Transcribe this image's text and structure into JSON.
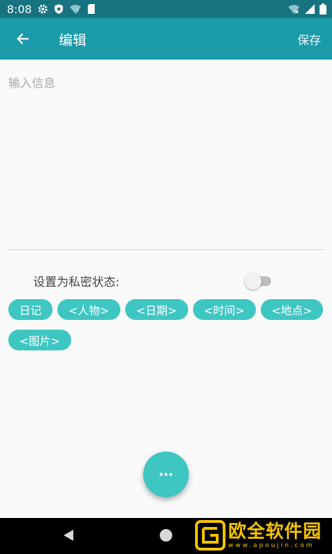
{
  "status_bar": {
    "time": "8:08",
    "icons": [
      "gear-icon",
      "shield-icon",
      "wifi-question-icon",
      "sd-card-icon",
      "wifi-x-icon",
      "signal-icon",
      "battery-icon"
    ]
  },
  "app_bar": {
    "title": "编辑",
    "save_label": "保存",
    "background": "#1b9aaa"
  },
  "editor": {
    "placeholder": "输入信息",
    "value": ""
  },
  "private_setting": {
    "label": "设置为私密状态:",
    "enabled": false
  },
  "tags": [
    {
      "label": "日记"
    },
    {
      "label": "<人物>"
    },
    {
      "label": "<日期>"
    },
    {
      "label": "<时间>"
    },
    {
      "label": "<地点>"
    },
    {
      "label": "<图片>"
    }
  ],
  "accent_color": "#3ec6c2",
  "fab": {
    "icon": "more-dots-icon"
  },
  "watermark": {
    "name": "欧全软件园",
    "url": "www.apoujin.com"
  }
}
